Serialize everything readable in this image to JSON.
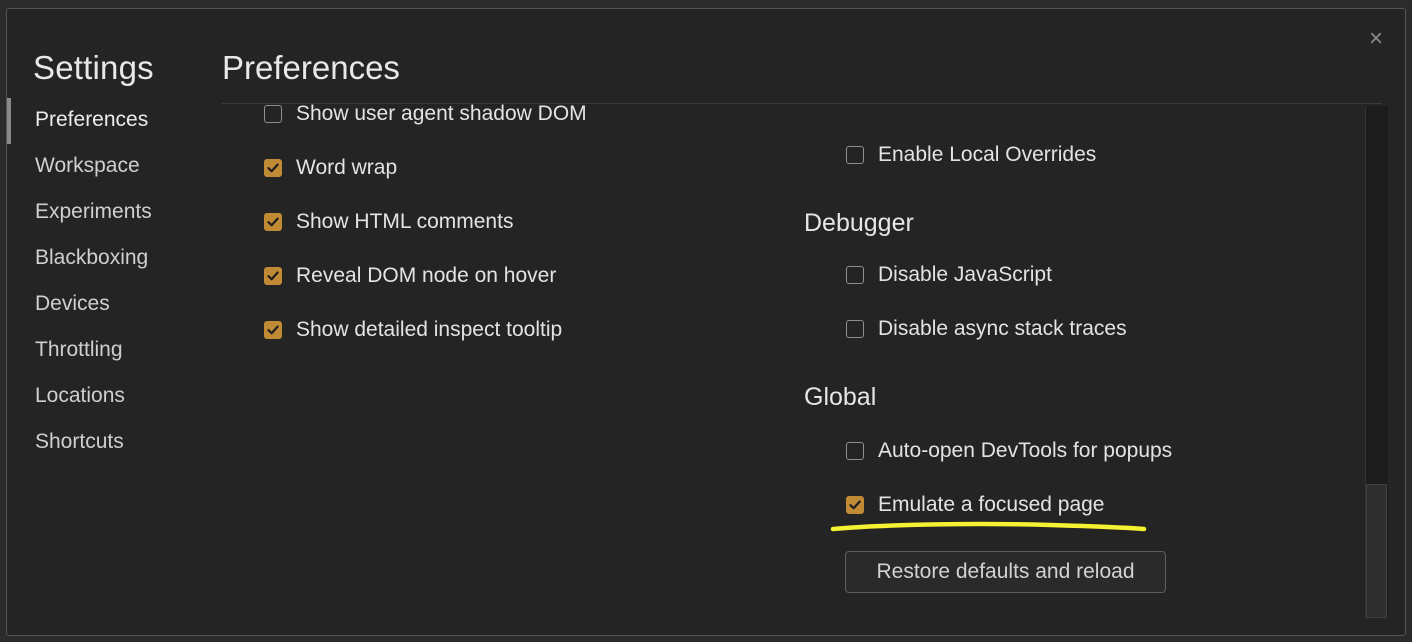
{
  "dialog": {
    "close_glyph": "×",
    "settings_title": "Settings",
    "section_title": "Preferences"
  },
  "sidebar": {
    "items": [
      {
        "label": "Preferences",
        "active": true
      },
      {
        "label": "Workspace"
      },
      {
        "label": "Experiments"
      },
      {
        "label": "Blackboxing"
      },
      {
        "label": "Devices"
      },
      {
        "label": "Throttling"
      },
      {
        "label": "Locations"
      },
      {
        "label": "Shortcuts"
      }
    ]
  },
  "elements_options": [
    {
      "label": "Show user agent shadow DOM",
      "checked": false
    },
    {
      "label": "Word wrap",
      "checked": true
    },
    {
      "label": "Show HTML comments",
      "checked": true
    },
    {
      "label": "Reveal DOM node on hover",
      "checked": true
    },
    {
      "label": "Show detailed inspect tooltip",
      "checked": true
    }
  ],
  "sources_options": [
    {
      "label": "Enable Local Overrides",
      "checked": false
    }
  ],
  "debugger": {
    "title": "Debugger",
    "options": [
      {
        "label": "Disable JavaScript",
        "checked": false
      },
      {
        "label": "Disable async stack traces",
        "checked": false
      }
    ]
  },
  "global": {
    "title": "Global",
    "options": [
      {
        "label": "Auto-open DevTools for popups",
        "checked": false
      },
      {
        "label": "Emulate a focused page",
        "checked": true
      }
    ]
  },
  "restore_button_label": "Restore defaults and reload",
  "colors": {
    "accent": "#c18a35",
    "highlight": "#f5f232",
    "background": "#242424"
  }
}
